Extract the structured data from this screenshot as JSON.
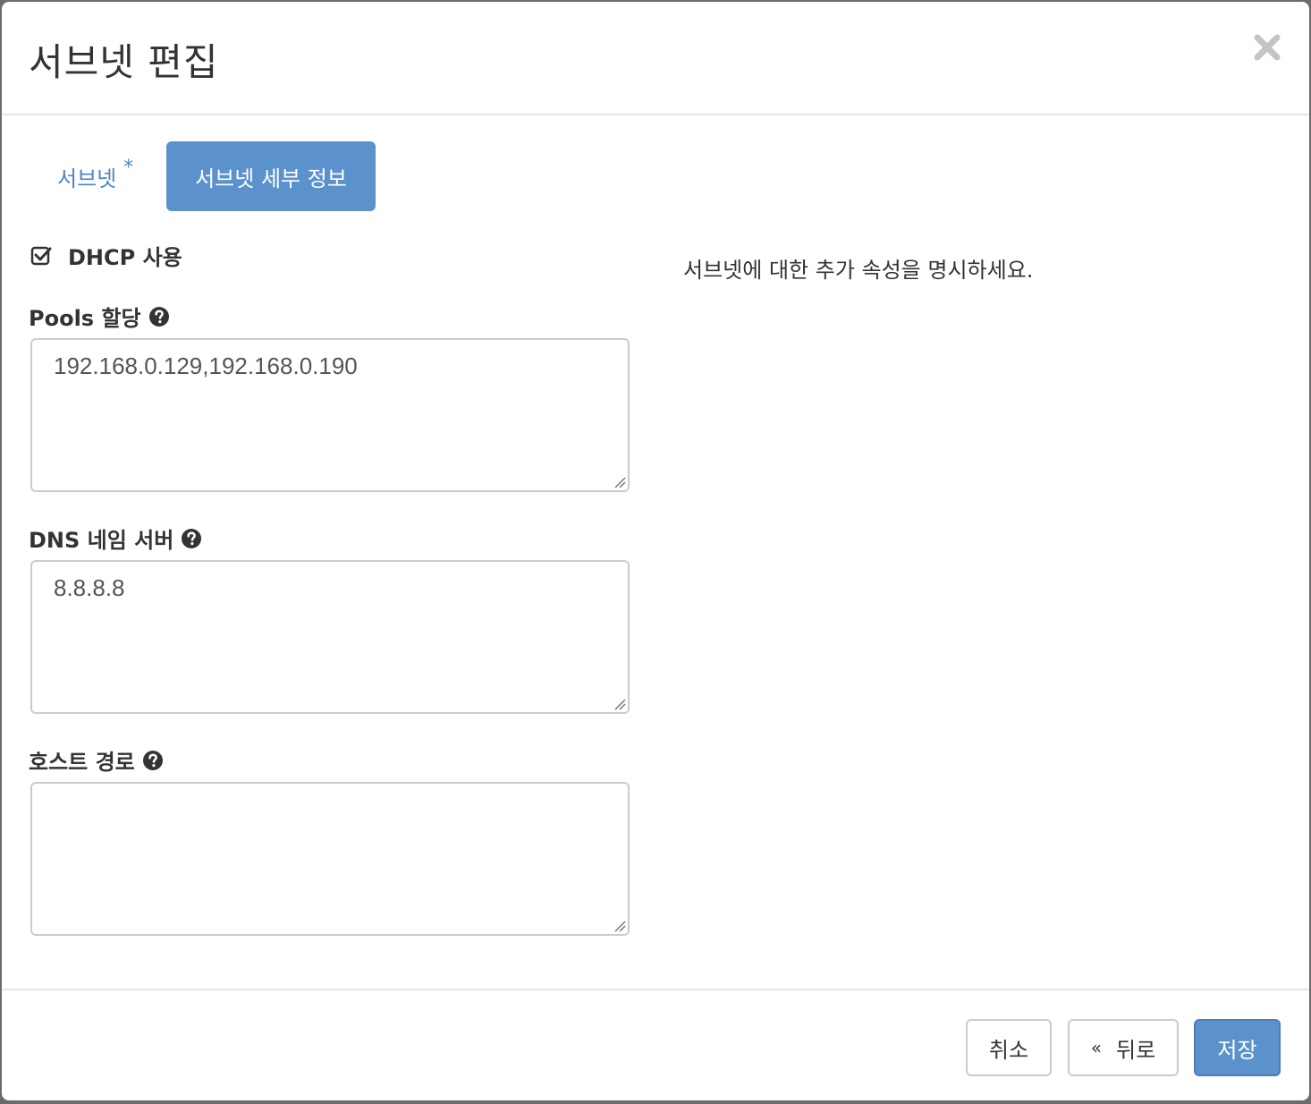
{
  "dialog": {
    "title": "서브넷 편집",
    "close_icon": "close-icon"
  },
  "tabs": [
    {
      "label": "서브넷",
      "required_marker": "*",
      "active": false
    },
    {
      "label": "서브넷 세부 정보",
      "active": true
    }
  ],
  "form": {
    "dhcp": {
      "label": "DHCP 사용",
      "checked": true
    },
    "pools": {
      "label": "Pools 할당",
      "value": "192.168.0.129,192.168.0.190"
    },
    "dns": {
      "label": "DNS 네임 서버",
      "value": "8.8.8.8"
    },
    "host_routes": {
      "label": "호스트 경로",
      "value": ""
    }
  },
  "helper_text": "서브넷에 대한 추가 속성을 명시하세요.",
  "footer": {
    "cancel_label": "취소",
    "back_chevron": "«",
    "back_label": "뒤로",
    "save_label": "저장"
  },
  "colors": {
    "primary": "#5b92cc",
    "link": "#4a86c5",
    "border": "#cccccc",
    "divider": "#e5e5e5"
  }
}
